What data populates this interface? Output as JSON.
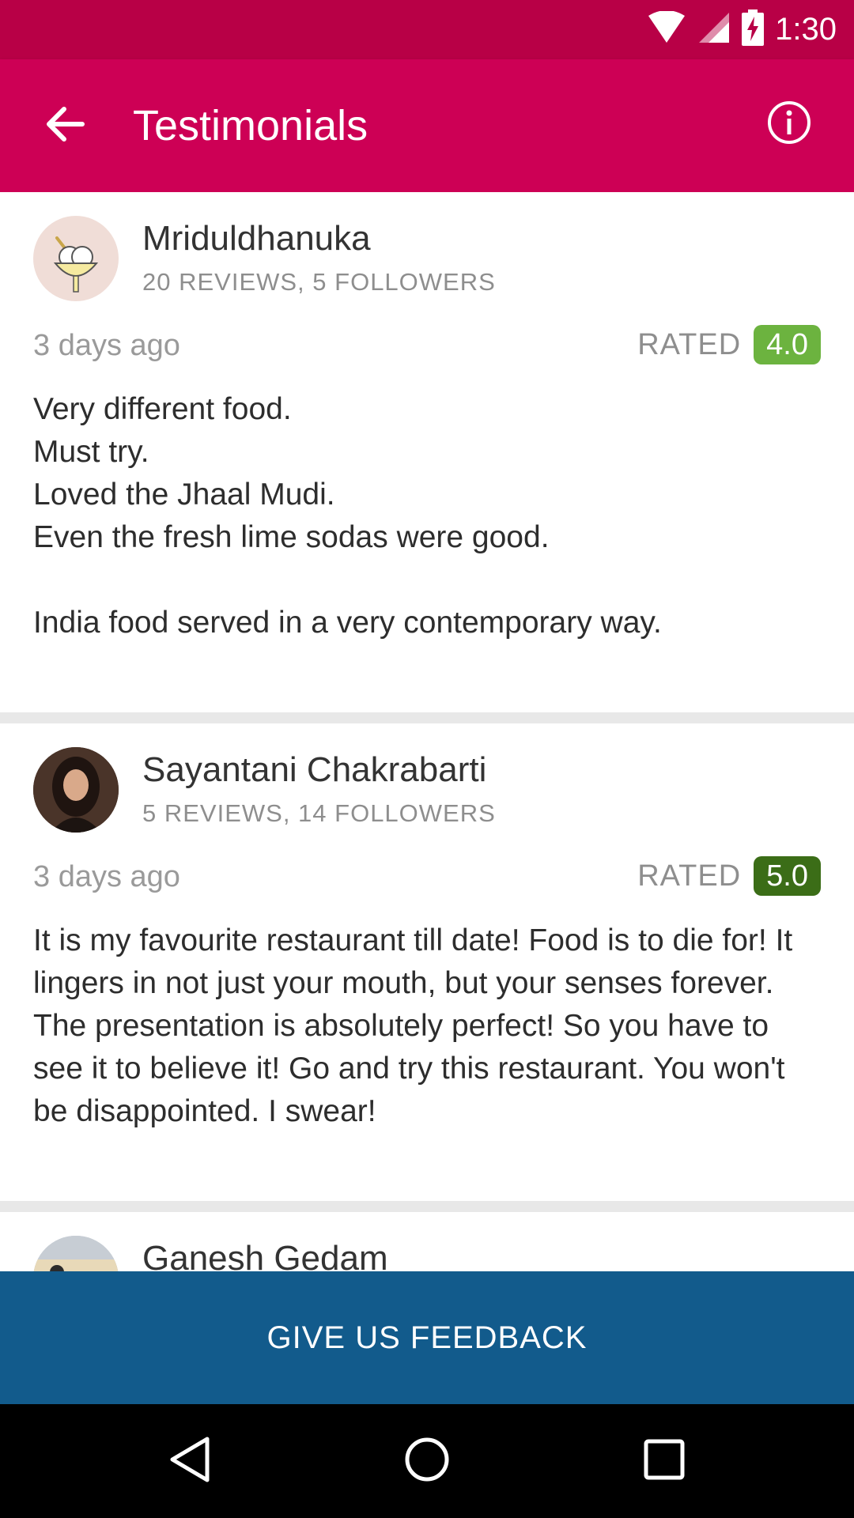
{
  "status_bar": {
    "time": "1:30"
  },
  "toolbar": {
    "title": "Testimonials"
  },
  "reviews": [
    {
      "name": "Mriduldhanuka",
      "stats": "20 REVIEWS, 5 FOLLOWERS",
      "time": "3 days ago",
      "rated_label": "RATED",
      "rating": "4.0",
      "rating_color": "#6cb33f",
      "text": "Very different food.\nMust try.\nLoved the Jhaal Mudi.\nEven the fresh lime sodas were good.\n\nIndia food served in a very contemporary way."
    },
    {
      "name": "Sayantani Chakrabarti",
      "stats": "5 REVIEWS, 14 FOLLOWERS",
      "time": "3 days ago",
      "rated_label": "RATED",
      "rating": "5.0",
      "rating_color": "#3b6d17",
      "text": "It is my favourite restaurant till date! Food is to die for! It lingers in not just your mouth, but your senses forever. The presentation is absolutely perfect! So you have to see it to believe it! Go and try this restaurant. You won't be disappointed. I swear!"
    },
    {
      "name": "Ganesh Gedam"
    }
  ],
  "feedback_button": {
    "label": "GIVE US FEEDBACK"
  },
  "colors": {
    "status_bar": "#b80046",
    "toolbar": "#cd0055",
    "feedback_bar": "#125b8c"
  },
  "icons": {
    "back": "arrow-left-icon",
    "info": "info-circle-icon",
    "nav": [
      "back-triangle-icon",
      "home-circle-icon",
      "recents-square-icon"
    ]
  }
}
